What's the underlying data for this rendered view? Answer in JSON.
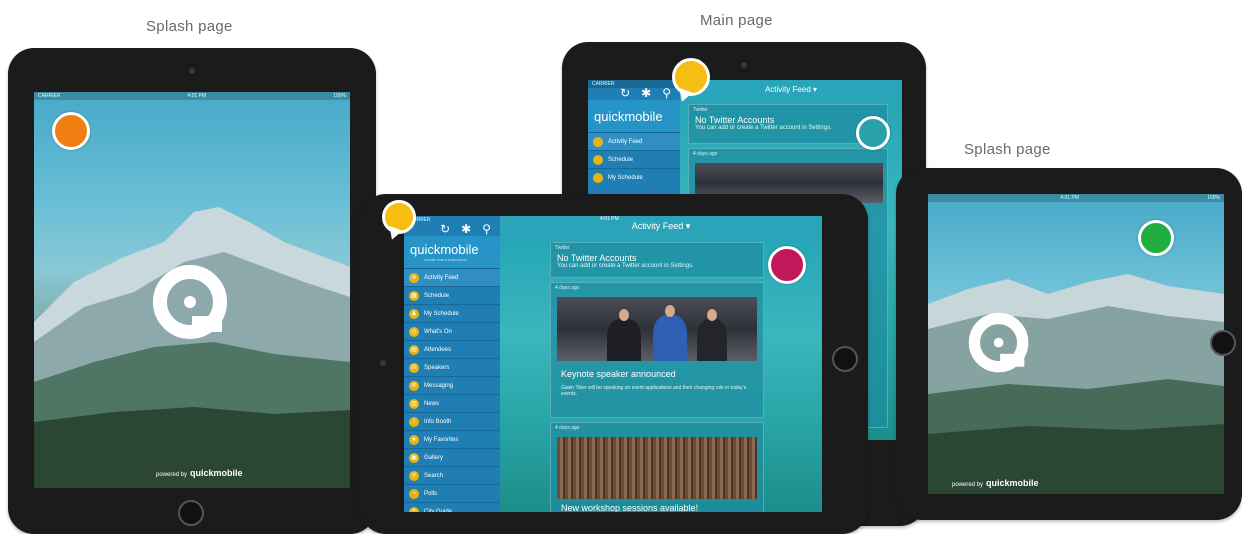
{
  "captions": {
    "left": "Splash page",
    "center": "Main page",
    "right": "Splash page"
  },
  "splash": {
    "powered_by": "powered by",
    "brand": "quickmobile"
  },
  "app": {
    "status_time": "4:01 PM",
    "battery": "100%",
    "carrier": "CARRIER",
    "toolbar_icons": [
      "refresh-icon",
      "gear-icon",
      "search-icon"
    ],
    "logo_text": "quickmobile",
    "logo_tagline": "mobile event experience",
    "feed_title": "Activity Feed",
    "menu": [
      {
        "label": "Activity Feed",
        "icon": "activity-icon",
        "active": true
      },
      {
        "label": "Schedule",
        "icon": "calendar-icon"
      },
      {
        "label": "My Schedule",
        "icon": "person-calendar-icon"
      },
      {
        "label": "What's On",
        "icon": "clock-icon"
      },
      {
        "label": "Attendees",
        "icon": "attendees-icon"
      },
      {
        "label": "Speakers",
        "icon": "speaker-icon"
      },
      {
        "label": "Messaging",
        "icon": "envelope-icon"
      },
      {
        "label": "News",
        "icon": "news-icon"
      },
      {
        "label": "Info Booth",
        "icon": "info-icon"
      },
      {
        "label": "My Favorites",
        "icon": "star-icon"
      },
      {
        "label": "Gallery",
        "icon": "gallery-icon"
      },
      {
        "label": "Search",
        "icon": "search-icon"
      },
      {
        "label": "Polls",
        "icon": "poll-icon"
      },
      {
        "label": "City Guide",
        "icon": "map-icon"
      }
    ],
    "cards": [
      {
        "meta": "Twitter",
        "title": "No Twitter Accounts",
        "subtitle": "You can add or create a Twitter account in Settings."
      },
      {
        "meta": "4 days ago",
        "title": "Keynote speaker announced",
        "subtitle": "Gavin Tiber will be speaking on event applications and their changing role in today's events."
      },
      {
        "meta": "4 days ago",
        "title": "New workshop sessions available!",
        "subtitle": ""
      }
    ]
  },
  "markers": {
    "orange": "#f07f12",
    "yellow": "#f6bd12",
    "magenta": "#c2185b",
    "teal": "#2aa0a8",
    "green": "#1fae3f"
  }
}
